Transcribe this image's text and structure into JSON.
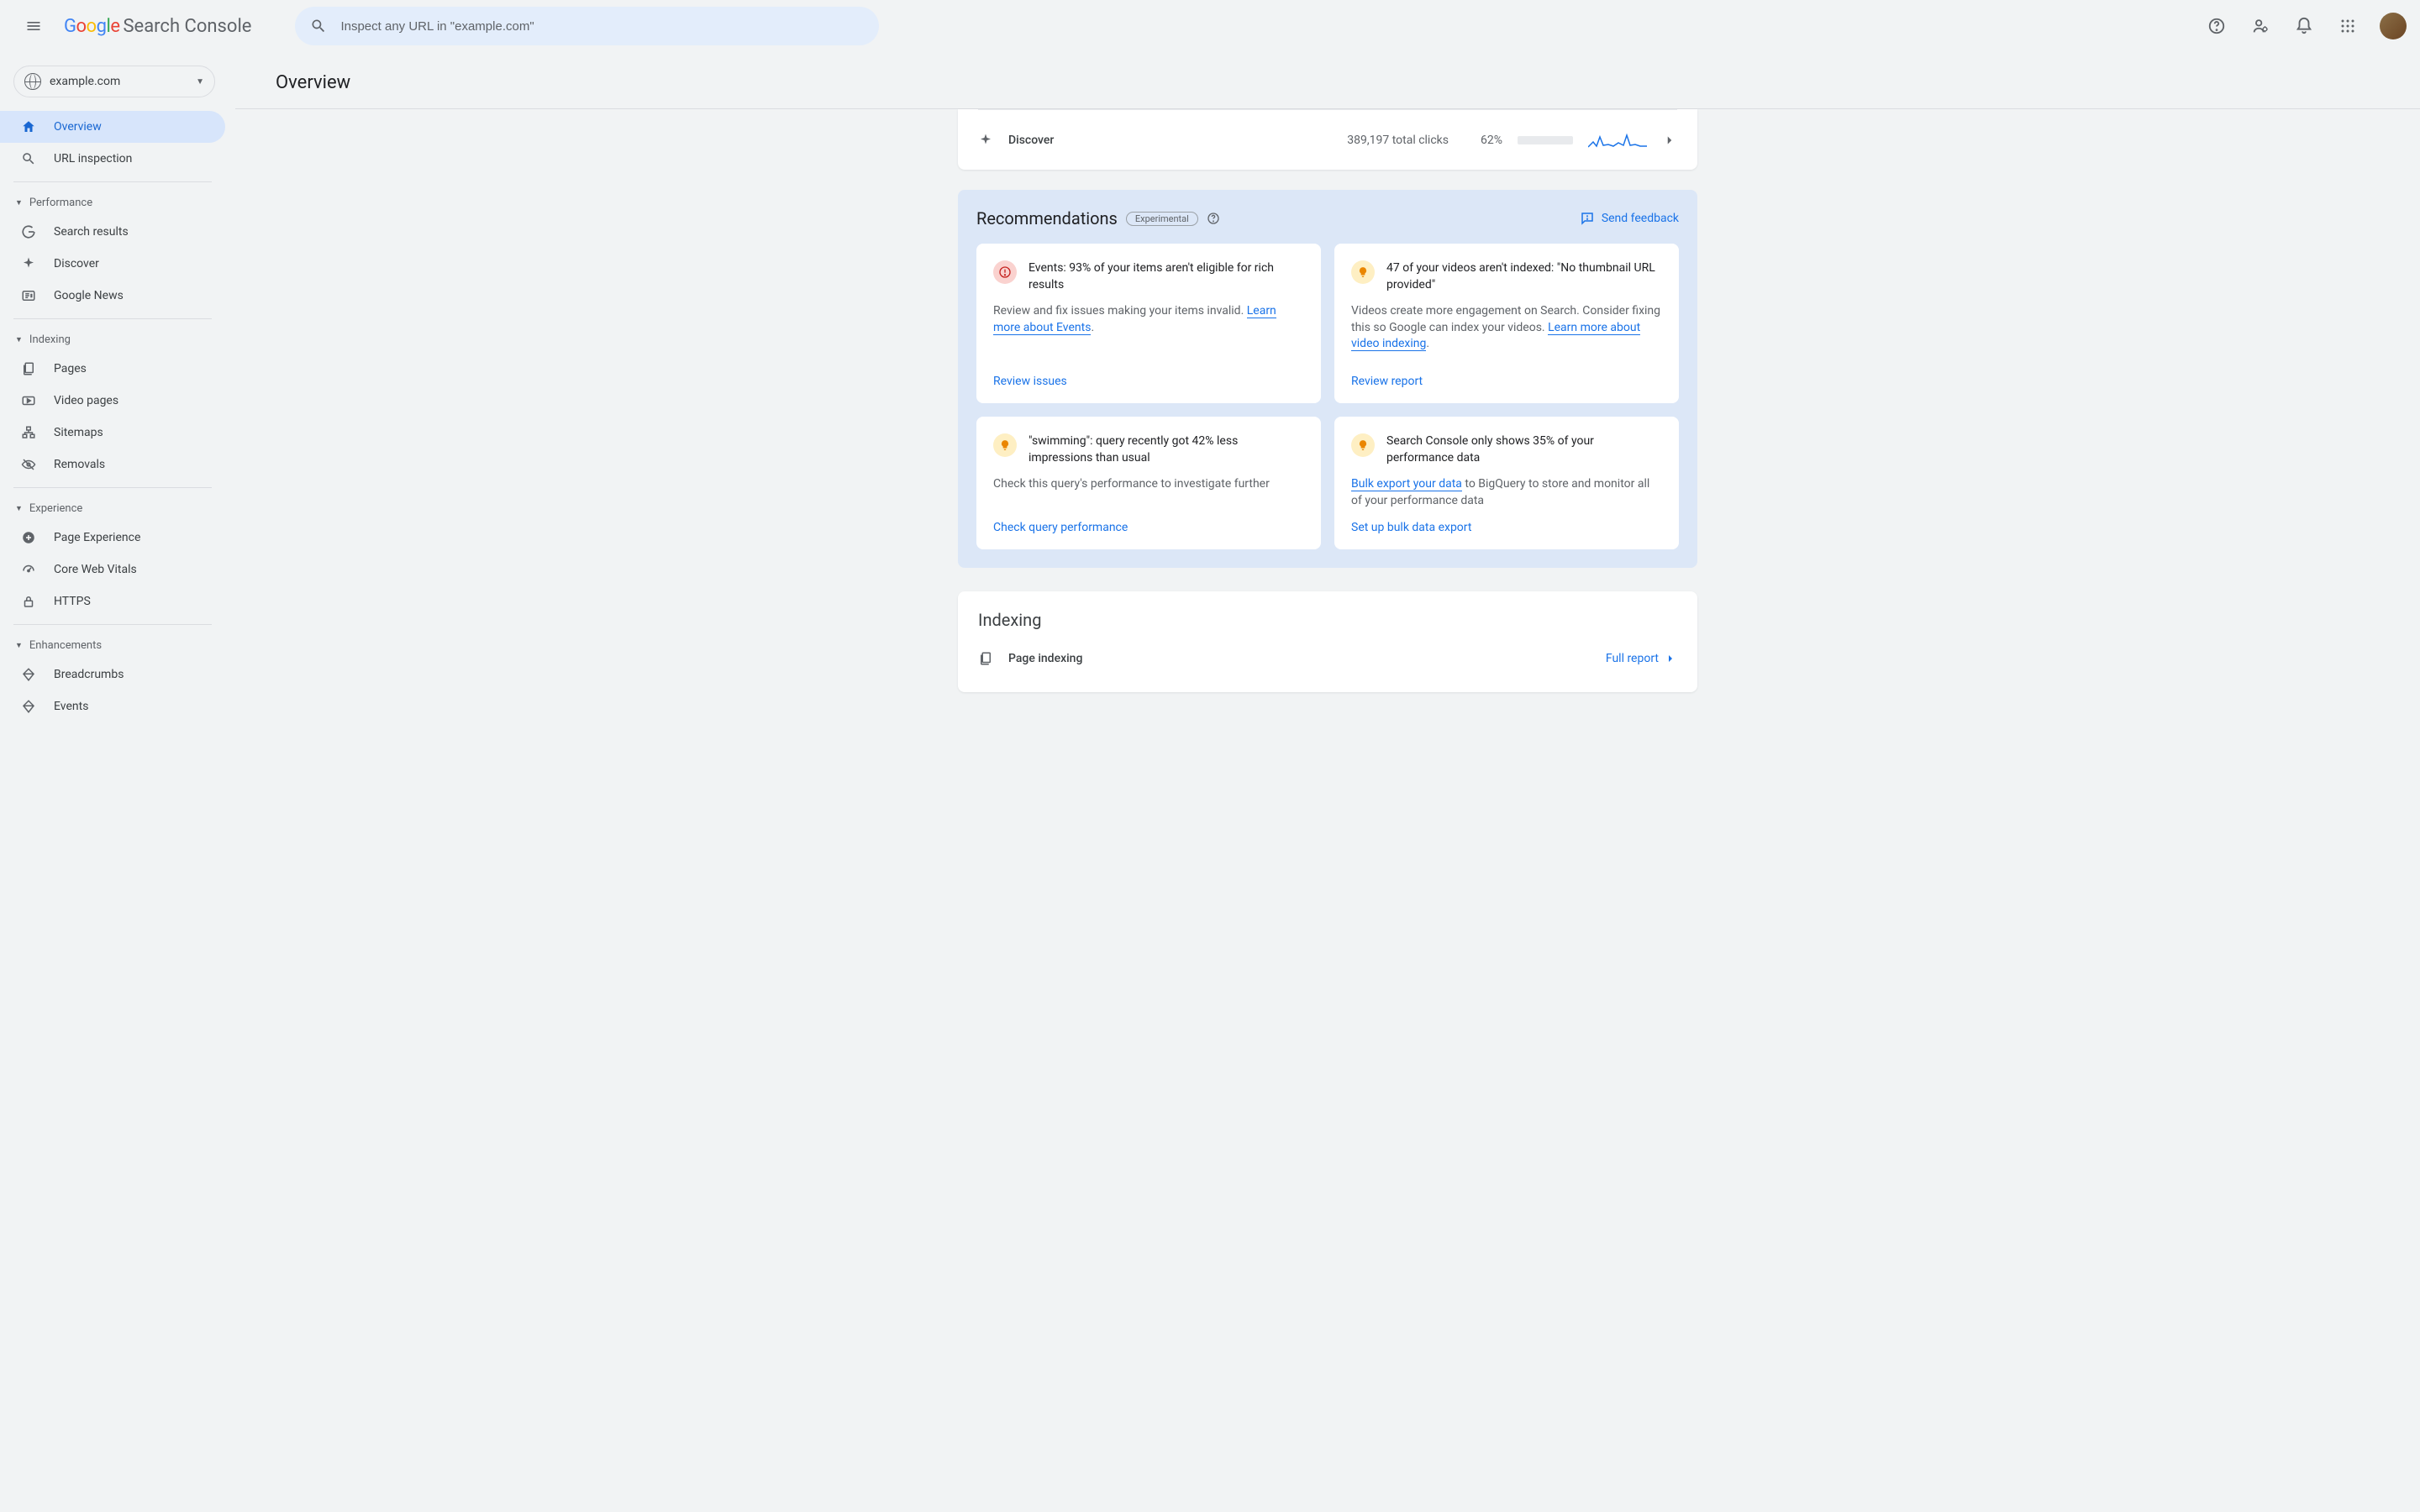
{
  "search": {
    "placeholder": "Inspect any URL in \"example.com\""
  },
  "property": {
    "domain": "example.com"
  },
  "sidebar": {
    "overview": "Overview",
    "url_inspection": "URL inspection",
    "sections": {
      "performance": "Performance",
      "indexing": "Indexing",
      "experience": "Experience",
      "enhancements": "Enhancements"
    },
    "performance_items": [
      "Search results",
      "Discover",
      "Google News"
    ],
    "indexing_items": [
      "Pages",
      "Video pages",
      "Sitemaps",
      "Removals"
    ],
    "experience_items": [
      "Page Experience",
      "Core Web Vitals",
      "HTTPS"
    ],
    "enhancements_items": [
      "Breadcrumbs",
      "Events"
    ]
  },
  "page": {
    "title": "Overview"
  },
  "discover": {
    "label": "Discover",
    "clicks": "389,197 total clicks",
    "percent": "62%",
    "percent_num": 62
  },
  "recommendations": {
    "title": "Recommendations",
    "badge": "Experimental",
    "send_feedback": "Send feedback",
    "cards": [
      {
        "icon": "error",
        "title": "Events: 93% of your items aren't eligible for rich results",
        "body_pre": "Review and fix issues making your items invalid. ",
        "link": "Learn more about Events",
        "body_post": ".",
        "action": "Review issues"
      },
      {
        "icon": "tip",
        "title": "47 of your videos aren't indexed: \"No thumbnail URL provided\"",
        "body_pre": "Videos create more engagement on Search. Consider fixing this so Google can index your videos. ",
        "link": "Learn more about video indexing",
        "body_post": ".",
        "action": "Review report"
      },
      {
        "icon": "tip",
        "title": "\"swimming\": query recently got 42% less impressions than usual",
        "body_pre": "Check this query's performance to investigate further",
        "link": "",
        "body_post": "",
        "action": "Check query performance"
      },
      {
        "icon": "tip",
        "title": "Search Console only shows 35% of your performance data",
        "body_pre": "",
        "link": "Bulk export your data",
        "body_post": " to BigQuery to store and monitor all of your performance data",
        "action": "Set up bulk data export"
      }
    ]
  },
  "indexing": {
    "title": "Indexing",
    "row_label": "Page indexing",
    "full_report": "Full report"
  }
}
